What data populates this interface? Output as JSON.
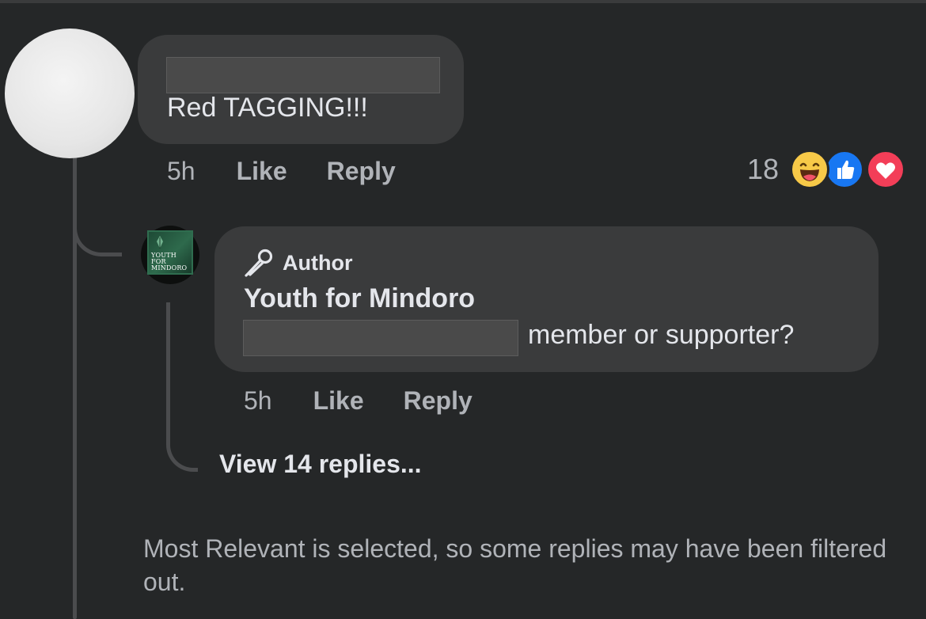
{
  "comment": {
    "text": "Red TAGGING!!!",
    "time": "5h",
    "like_label": "Like",
    "reply_label": "Reply",
    "reaction_count": "18",
    "reactions": [
      "haha-icon",
      "like-icon",
      "love-icon"
    ]
  },
  "reply": {
    "badge": "Author",
    "author_name": "Youth for Mindoro",
    "avatar_text": "YOUTH FOR MINDORO",
    "text": "member or supporter?",
    "time": "5h",
    "like_label": "Like",
    "reply_label": "Reply"
  },
  "view_replies_label": "View 14 replies...",
  "filter_note": "Most Relevant is selected, so some replies may have been filtered out.",
  "colors": {
    "background": "#252728",
    "bubble": "#3a3b3c",
    "text_primary": "#e4e6eb",
    "text_secondary": "#b0b3b8",
    "like_blue": "#1877f2",
    "love_red": "#f33e58",
    "haha_yellow": "#f7c948"
  }
}
